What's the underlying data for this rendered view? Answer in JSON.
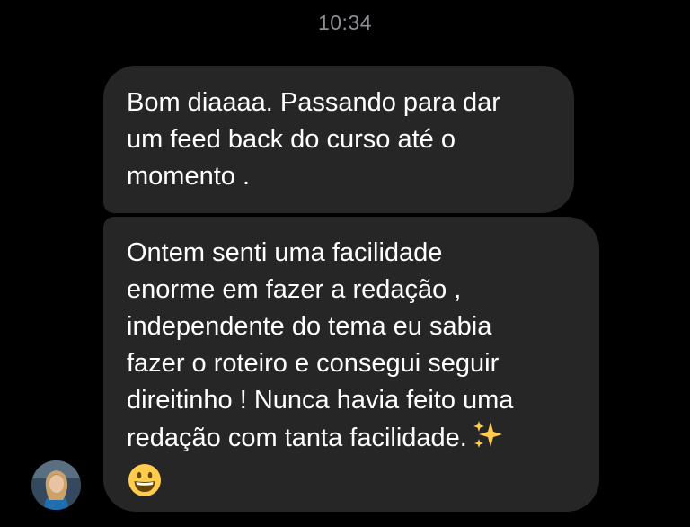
{
  "status": {
    "time": "10:34"
  },
  "messages": [
    {
      "text": "Bom diaaaa. Passando para dar\num feed back do curso até o\nmomento ."
    },
    {
      "text": "Ontem senti uma facilidade\nenorme em fazer a redação ,\nindependente do tema eu sabia\nfazer o roteiro e consegui seguir\ndireitinho ! Nunca havia feito uma\nredação com tanta facilidade.",
      "emojis": [
        "sparkles-emoji",
        "grinning-face-emoji"
      ]
    }
  ],
  "sender": {
    "avatar": "profile-photo"
  },
  "colors": {
    "background": "#000000",
    "bubble": "#262626",
    "text": "#ffffff",
    "timestamp": "#8e8e93"
  }
}
